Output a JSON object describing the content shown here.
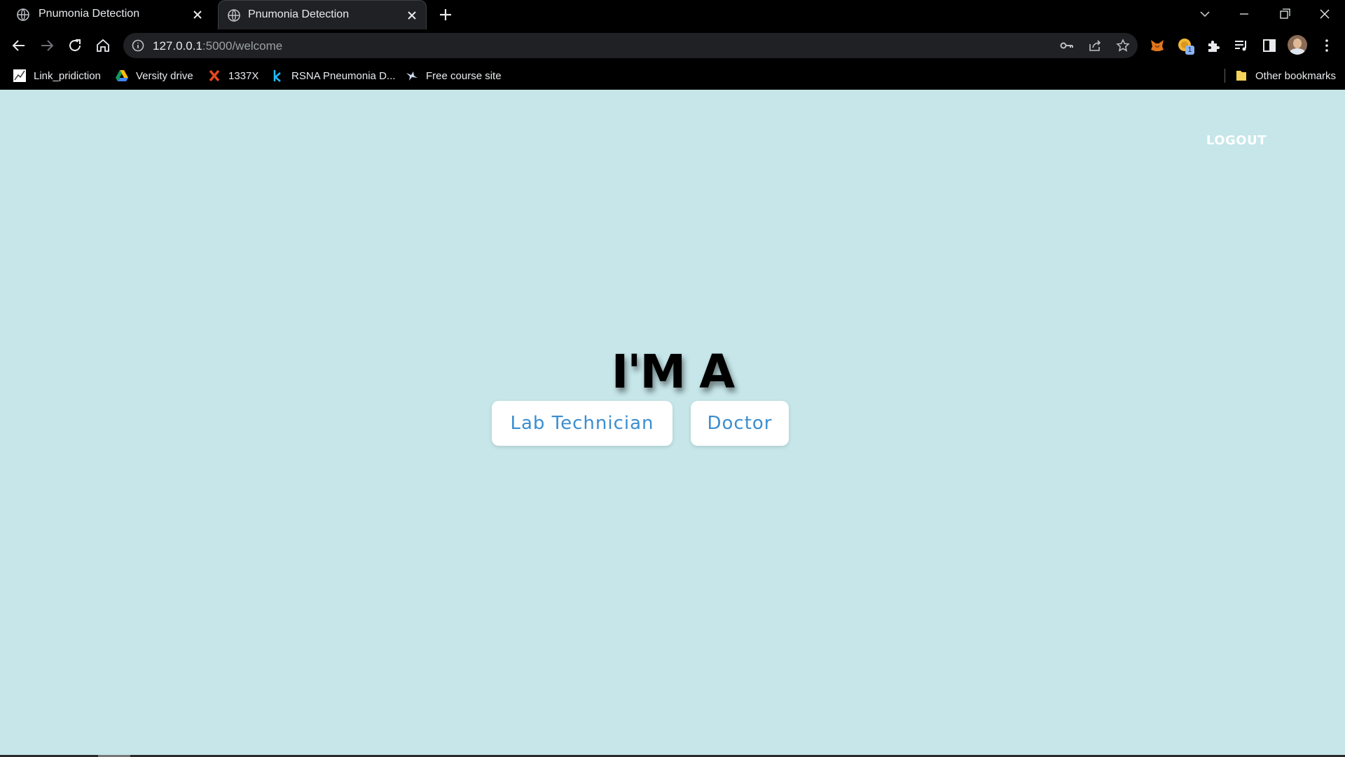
{
  "browser": {
    "tabs": [
      {
        "title": "Pnumonia Detection",
        "active": false
      },
      {
        "title": "Pnumonia Detection",
        "active": true
      }
    ],
    "address_bar": {
      "host": "127.0.0.1",
      "path": ":5000/welcome"
    },
    "bookmarks": [
      {
        "label": "Link_pridiction",
        "icon": "chart-icon"
      },
      {
        "label": "Versity drive",
        "icon": "google-drive-icon"
      },
      {
        "label": "1337X",
        "icon": "x-icon"
      },
      {
        "label": "RSNA Pneumonia D...",
        "icon": "kaggle-icon"
      },
      {
        "label": "Free course site",
        "icon": "bird-icon"
      }
    ],
    "other_bookmarks": "Other bookmarks",
    "extension_badge": "1"
  },
  "page": {
    "logout_label": "LOGOUT",
    "heading": "I'M A",
    "roles": [
      "Lab Technician",
      "Doctor"
    ]
  },
  "colors": {
    "page_background": "#c6e6e9",
    "button_text": "#3b8ed0",
    "browser_chrome": "#000000"
  }
}
